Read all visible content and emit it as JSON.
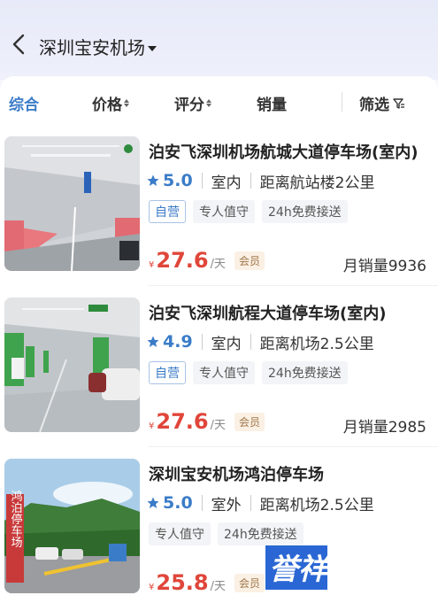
{
  "header": {
    "location": "深圳宝安机场"
  },
  "sort_bar": {
    "items": [
      "综合",
      "价格",
      "评分",
      "销量"
    ],
    "filter_label": "筛选"
  },
  "listings": [
    {
      "title": "泊安飞深圳机场航城大道停车场(室内)",
      "score": "5.0",
      "type": "室内",
      "distance": "距离航站楼2公里",
      "tags": [
        "自营",
        "专人值守",
        "24h免费接送"
      ],
      "currency": "¥",
      "price": "27.6",
      "unit": "/天",
      "member": "会员",
      "sales": "月销量9936"
    },
    {
      "title": "泊安飞深圳航程大道停车场(室内)",
      "score": "4.9",
      "type": "室内",
      "distance": "距离机场2.5公里",
      "tags": [
        "自营",
        "专人值守",
        "24h免费接送"
      ],
      "currency": "¥",
      "price": "27.6",
      "unit": "/天",
      "member": "会员",
      "sales": "月销量2985"
    },
    {
      "title": "深圳宝安机场鸿泊停车场",
      "score": "5.0",
      "type": "室外",
      "distance": "距离机场2.5公里",
      "tags": [
        "专人值守",
        "24h免费接送"
      ],
      "currency": "¥",
      "price": "25.8",
      "unit": "/天",
      "member": "会员",
      "sign_text": "鸿泊停车场"
    }
  ],
  "watermark": {
    "text": "誉祥祥知识"
  },
  "colors": {
    "accent": "#3b7cc8",
    "price": "#e0463a"
  }
}
